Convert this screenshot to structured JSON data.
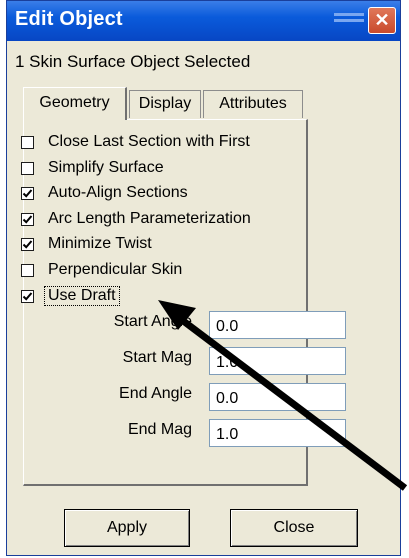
{
  "window": {
    "title": "Edit Object",
    "close_glyph": "✕"
  },
  "selection_label": "1 Skin Surface Object Selected",
  "tabs": [
    {
      "label": "Geometry",
      "active": true
    },
    {
      "label": "Display",
      "active": false
    },
    {
      "label": "Attributes",
      "active": false
    }
  ],
  "options": [
    {
      "label": "Close Last Section with First",
      "checked": false
    },
    {
      "label": "Simplify Surface",
      "checked": false
    },
    {
      "label": "Auto-Align Sections",
      "checked": true
    },
    {
      "label": "Arc Length Parameterization",
      "checked": true
    },
    {
      "label": "Minimize Twist",
      "checked": true
    },
    {
      "label": "Perpendicular Skin",
      "checked": false
    },
    {
      "label": "Use Draft",
      "checked": true
    }
  ],
  "draft_fields": [
    {
      "label": "Start Angle",
      "value": "0.0"
    },
    {
      "label": "Start Mag",
      "value": "1.0"
    },
    {
      "label": "End Angle",
      "value": "0.0"
    },
    {
      "label": "End Mag",
      "value": "1.0"
    }
  ],
  "buttons": {
    "apply": "Apply",
    "close": "Close"
  },
  "colors": {
    "titlebar": "#0a5bdb",
    "annotation_arrow": "#000000"
  }
}
